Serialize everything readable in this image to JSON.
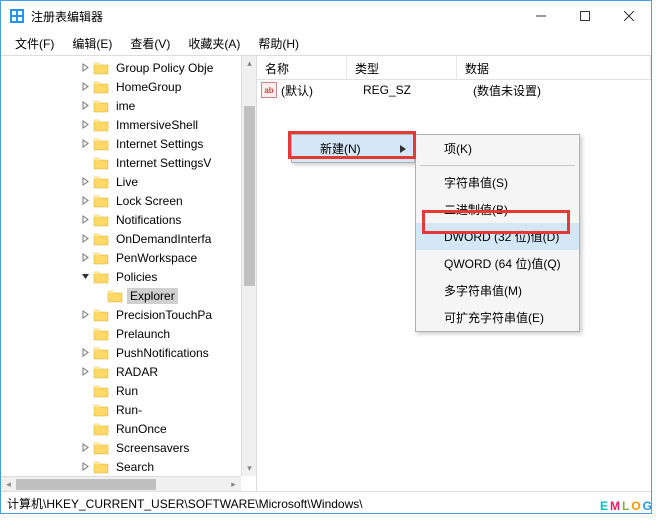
{
  "title": "注册表编辑器",
  "menubar": [
    "文件(F)",
    "编辑(E)",
    "查看(V)",
    "收藏夹(A)",
    "帮助(H)"
  ],
  "tree": [
    {
      "label": "Group Policy Obje",
      "depth": 5,
      "expander": "right"
    },
    {
      "label": "HomeGroup",
      "depth": 5,
      "expander": "right"
    },
    {
      "label": "ime",
      "depth": 5,
      "expander": "right"
    },
    {
      "label": "ImmersiveShell",
      "depth": 5,
      "expander": "right"
    },
    {
      "label": "Internet Settings",
      "depth": 5,
      "expander": "right"
    },
    {
      "label": "Internet SettingsV",
      "depth": 5,
      "expander": "none"
    },
    {
      "label": "Live",
      "depth": 5,
      "expander": "right"
    },
    {
      "label": "Lock Screen",
      "depth": 5,
      "expander": "right"
    },
    {
      "label": "Notifications",
      "depth": 5,
      "expander": "right"
    },
    {
      "label": "OnDemandInterfa",
      "depth": 5,
      "expander": "right"
    },
    {
      "label": "PenWorkspace",
      "depth": 5,
      "expander": "right"
    },
    {
      "label": "Policies",
      "depth": 5,
      "expander": "down"
    },
    {
      "label": "Explorer",
      "depth": 6,
      "expander": "none",
      "selected": true
    },
    {
      "label": "PrecisionTouchPa",
      "depth": 5,
      "expander": "right"
    },
    {
      "label": "Prelaunch",
      "depth": 5,
      "expander": "none"
    },
    {
      "label": "PushNotifications",
      "depth": 5,
      "expander": "right"
    },
    {
      "label": "RADAR",
      "depth": 5,
      "expander": "right"
    },
    {
      "label": "Run",
      "depth": 5,
      "expander": "none"
    },
    {
      "label": "Run-",
      "depth": 5,
      "expander": "none"
    },
    {
      "label": "RunOnce",
      "depth": 5,
      "expander": "none"
    },
    {
      "label": "Screensavers",
      "depth": 5,
      "expander": "right"
    },
    {
      "label": "Search",
      "depth": 5,
      "expander": "right"
    }
  ],
  "list": {
    "headers": {
      "name": "名称",
      "type": "类型",
      "data": "数据"
    },
    "rows": [
      {
        "icon": "ab",
        "name": "(默认)",
        "type": "REG_SZ",
        "data": "(数值未设置)"
      }
    ]
  },
  "context_menu": {
    "parent_label": "新建(N)",
    "items": [
      {
        "label": "项(K)"
      },
      {
        "sep": true
      },
      {
        "label": "字符串值(S)"
      },
      {
        "label": "二进制值(B)"
      },
      {
        "label": "DWORD (32 位)值(D)",
        "highlight": true
      },
      {
        "label": "QWORD (64 位)值(Q)"
      },
      {
        "label": "多字符串值(M)"
      },
      {
        "label": "可扩充字符串值(E)"
      }
    ]
  },
  "statusbar": "计算机\\HKEY_CURRENT_USER\\SOFTWARE\\Microsoft\\Windows\\",
  "watermark": {
    "e": "E",
    "m": "M",
    "l": "L",
    "o": "O",
    "g": "G"
  }
}
